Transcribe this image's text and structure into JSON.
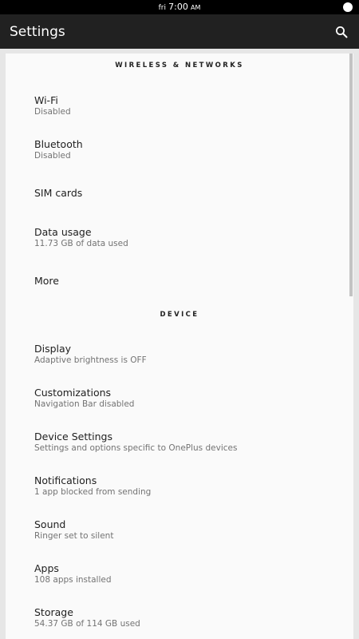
{
  "status_bar": {
    "day": "fri",
    "time": "7:00",
    "ampm": "AM"
  },
  "app_bar": {
    "title": "Settings",
    "search_icon": "search-icon"
  },
  "colors": {
    "status_bar_bg": "#000000",
    "app_bar_bg": "#212121",
    "page_bg": "#e6e6e6",
    "card_bg": "#fafafa",
    "title_text": "#212121",
    "summary_text": "#737373"
  },
  "sections": {
    "wireless": {
      "header": "WIRELESS & NETWORKS",
      "items": [
        {
          "title": "Wi-Fi",
          "summary": "Disabled"
        },
        {
          "title": "Bluetooth",
          "summary": "Disabled"
        },
        {
          "title": "SIM cards",
          "summary": ""
        },
        {
          "title": "Data usage",
          "summary": "11.73 GB of data used"
        },
        {
          "title": "More",
          "summary": ""
        }
      ]
    },
    "device": {
      "header": "DEVICE",
      "items": [
        {
          "title": "Display",
          "summary": "Adaptive brightness is OFF"
        },
        {
          "title": "Customizations",
          "summary": "Navigation Bar disabled"
        },
        {
          "title": "Device Settings",
          "summary": "Settings and options specific to OnePlus devices"
        },
        {
          "title": "Notifications",
          "summary": "1 app blocked from sending"
        },
        {
          "title": "Sound",
          "summary": "Ringer set to silent"
        },
        {
          "title": "Apps",
          "summary": "108 apps installed"
        },
        {
          "title": "Storage",
          "summary": "54.37 GB of 114 GB used"
        }
      ]
    }
  }
}
